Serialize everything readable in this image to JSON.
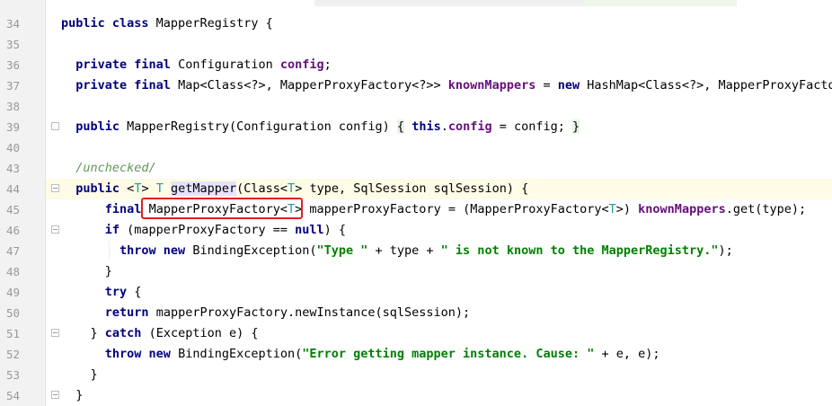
{
  "colors": {
    "keyword": "#000080",
    "field": "#660e7a",
    "string": "#008000",
    "type_param": "#20999d",
    "comment": "#629755",
    "line_number": "#999999",
    "caret_row": "#fefbe6",
    "annotation_box": "#e02020"
  },
  "editor": {
    "lines": [
      {
        "num": "34",
        "tokens": [
          {
            "t": "public class ",
            "c": "kw"
          },
          {
            "t": "MapperRegistry {",
            "c": ""
          }
        ]
      },
      {
        "num": "35",
        "tokens": []
      },
      {
        "num": "36",
        "tokens": [
          {
            "t": "  "
          },
          {
            "t": "private final ",
            "c": "kw"
          },
          {
            "t": "Configuration "
          },
          {
            "t": "config",
            "c": "fld"
          },
          {
            "t": ";"
          }
        ]
      },
      {
        "num": "37",
        "tokens": [
          {
            "t": "  "
          },
          {
            "t": "private final ",
            "c": "kw"
          },
          {
            "t": "Map<Class<?>, MapperProxyFactory<?>> "
          },
          {
            "t": "knownMappers",
            "c": "fld"
          },
          {
            "t": " = "
          },
          {
            "t": "new ",
            "c": "kw"
          },
          {
            "t": "HashMap<Class<?>, MapperProxyFactory"
          }
        ]
      },
      {
        "num": "38",
        "tokens": []
      },
      {
        "num": "39",
        "tokens": [
          {
            "t": "  "
          },
          {
            "t": "public ",
            "c": "kw"
          },
          {
            "t": "MapperRegistry(Configuration config) "
          },
          {
            "t": "{",
            "c": "brace-hl"
          },
          {
            "t": " "
          },
          {
            "t": "this",
            "c": "kw"
          },
          {
            "t": "."
          },
          {
            "t": "config",
            "c": "fld"
          },
          {
            "t": " = config; "
          },
          {
            "t": "}",
            "c": "brace-hl"
          }
        ]
      },
      {
        "num": "40",
        "tokens": []
      },
      {
        "num": "43",
        "tokens": [
          {
            "t": "  "
          },
          {
            "t": "/unchecked/",
            "c": "cmt"
          }
        ]
      },
      {
        "num": "44",
        "tokens": [
          {
            "t": "  "
          },
          {
            "t": "public ",
            "c": "kw"
          },
          {
            "t": "<"
          },
          {
            "t": "T",
            "c": "tp"
          },
          {
            "t": "> "
          },
          {
            "t": "T ",
            "c": "tp"
          },
          {
            "t": "getMapper",
            "c": "mhl"
          },
          {
            "t": "(Class<"
          },
          {
            "t": "T",
            "c": "tp"
          },
          {
            "t": "> type, SqlSession sqlSession) {"
          }
        ]
      },
      {
        "num": "45",
        "tokens": [
          {
            "t": "      "
          },
          {
            "t": "final ",
            "c": "kw"
          },
          {
            "t": "MapperProxyFactory<"
          },
          {
            "t": "T",
            "c": "tp"
          },
          {
            "t": "> mapperProxyFactory = (MapperProxyFactory<"
          },
          {
            "t": "T",
            "c": "tp"
          },
          {
            "t": ">) "
          },
          {
            "t": "knownMappers",
            "c": "fld"
          },
          {
            "t": ".get(type);"
          }
        ]
      },
      {
        "num": "46",
        "tokens": [
          {
            "t": "      "
          },
          {
            "t": "if ",
            "c": "kw"
          },
          {
            "t": "(mapperProxyFactory == "
          },
          {
            "t": "null",
            "c": "kw"
          },
          {
            "t": ") {"
          }
        ]
      },
      {
        "num": "47",
        "tokens": [
          {
            "t": "        "
          },
          {
            "t": "throw new ",
            "c": "kw"
          },
          {
            "t": "BindingException("
          },
          {
            "t": "\"Type \"",
            "c": "str"
          },
          {
            "t": " + type + "
          },
          {
            "t": "\" is not known to the MapperRegistry.\"",
            "c": "str"
          },
          {
            "t": ");"
          }
        ]
      },
      {
        "num": "48",
        "tokens": [
          {
            "t": "      }"
          }
        ]
      },
      {
        "num": "49",
        "tokens": [
          {
            "t": "      "
          },
          {
            "t": "try ",
            "c": "kw"
          },
          {
            "t": "{"
          }
        ]
      },
      {
        "num": "50",
        "tokens": [
          {
            "t": "      "
          },
          {
            "t": "return ",
            "c": "kw"
          },
          {
            "t": "mapperProxyFactory.newInstance(sqlSession);"
          }
        ]
      },
      {
        "num": "51",
        "tokens": [
          {
            "t": "    } "
          },
          {
            "t": "catch ",
            "c": "kw"
          },
          {
            "t": "(Exception e) {"
          }
        ]
      },
      {
        "num": "52",
        "tokens": [
          {
            "t": "      "
          },
          {
            "t": "throw new ",
            "c": "kw"
          },
          {
            "t": "BindingException("
          },
          {
            "t": "\"Error getting mapper instance. Cause: \"",
            "c": "str"
          },
          {
            "t": " + e, e);"
          }
        ]
      },
      {
        "num": "53",
        "tokens": [
          {
            "t": "    }"
          }
        ]
      },
      {
        "num": "54",
        "tokens": [
          {
            "t": "  }"
          }
        ]
      }
    ]
  },
  "icons": [
    "fold-icon"
  ]
}
